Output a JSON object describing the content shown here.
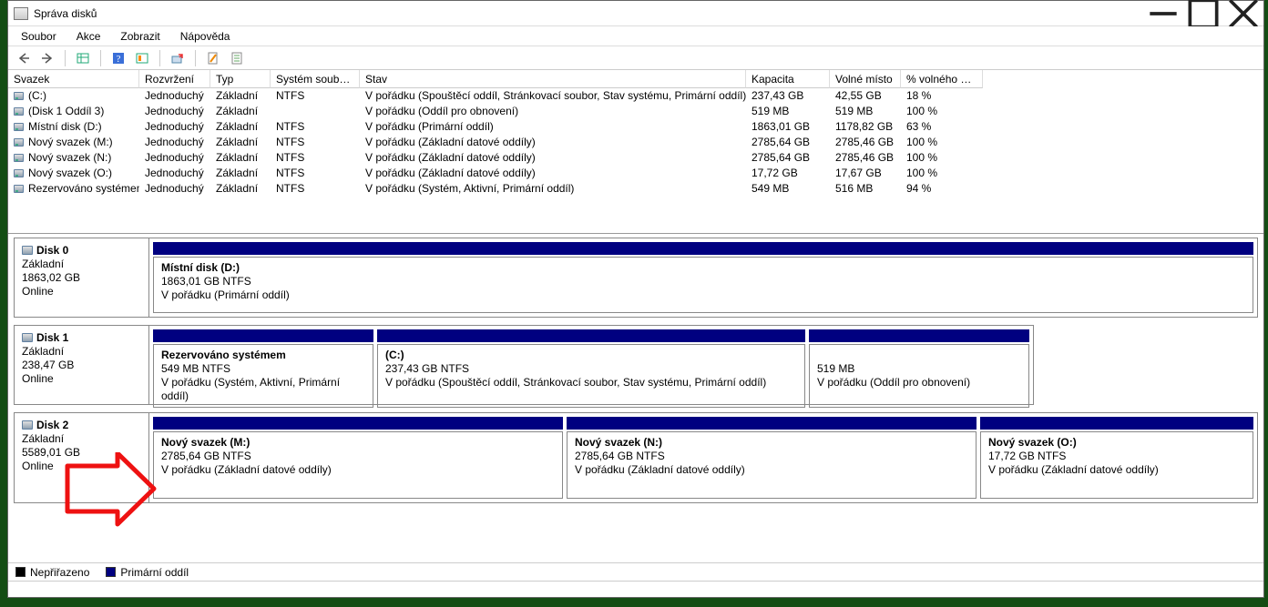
{
  "window": {
    "title": "Správa disků"
  },
  "menu": {
    "file": "Soubor",
    "action": "Akce",
    "view": "Zobrazit",
    "help": "Nápověda"
  },
  "columns": {
    "vol": "Svazek",
    "layout": "Rozvržení",
    "type": "Typ",
    "fs": "Systém souborů",
    "status": "Stav",
    "capacity": "Kapacita",
    "free": "Volné místo",
    "pctfree": "% volného m…"
  },
  "volumes": [
    {
      "name": "(C:)",
      "layout": "Jednoduchý",
      "type": "Základní",
      "fs": "NTFS",
      "status": "V pořádku (Spouštěcí oddíl, Stránkovací soubor, Stav systému, Primární oddíl)",
      "cap": "237,43 GB",
      "free": "42,55 GB",
      "pct": "18 %"
    },
    {
      "name": "(Disk 1 Oddíl 3)",
      "layout": "Jednoduchý",
      "type": "Základní",
      "fs": "",
      "status": "V pořádku (Oddíl pro obnovení)",
      "cap": "519 MB",
      "free": "519 MB",
      "pct": "100 %"
    },
    {
      "name": "Místní disk (D:)",
      "layout": "Jednoduchý",
      "type": "Základní",
      "fs": "NTFS",
      "status": "V pořádku (Primární oddíl)",
      "cap": "1863,01 GB",
      "free": "1178,82 GB",
      "pct": "63 %"
    },
    {
      "name": "Nový svazek (M:)",
      "layout": "Jednoduchý",
      "type": "Základní",
      "fs": "NTFS",
      "status": "V pořádku (Základní datové oddíly)",
      "cap": "2785,64 GB",
      "free": "2785,46 GB",
      "pct": "100 %"
    },
    {
      "name": "Nový svazek (N:)",
      "layout": "Jednoduchý",
      "type": "Základní",
      "fs": "NTFS",
      "status": "V pořádku (Základní datové oddíly)",
      "cap": "2785,64 GB",
      "free": "2785,46 GB",
      "pct": "100 %"
    },
    {
      "name": "Nový svazek (O:)",
      "layout": "Jednoduchý",
      "type": "Základní",
      "fs": "NTFS",
      "status": "V pořádku (Základní datové oddíly)",
      "cap": "17,72 GB",
      "free": "17,67 GB",
      "pct": "100 %"
    },
    {
      "name": "Rezervováno systémem",
      "layout": "Jednoduchý",
      "type": "Základní",
      "fs": "NTFS",
      "status": "V pořádku (Systém, Aktivní, Primární oddíl)",
      "cap": "549 MB",
      "free": "516 MB",
      "pct": "94 %"
    }
  ],
  "disks": {
    "d0": {
      "name": "Disk 0",
      "type": "Základní",
      "cap": "1863,02 GB",
      "state": "Online",
      "p0": {
        "title": "Místní disk  (D:)",
        "size": "1863,01 GB NTFS",
        "status": "V pořádku (Primární oddíl)"
      }
    },
    "d1": {
      "name": "Disk 1",
      "type": "Základní",
      "cap": "238,47 GB",
      "state": "Online",
      "p0": {
        "title": "Rezervováno systémem",
        "size": "549 MB NTFS",
        "status": "V pořádku (Systém, Aktivní, Primární oddíl)"
      },
      "p1": {
        "title": "(C:)",
        "size": "237,43 GB NTFS",
        "status": "V pořádku (Spouštěcí oddíl, Stránkovací soubor, Stav systému, Primární oddíl)"
      },
      "p2": {
        "title": "",
        "size": "519 MB",
        "status": "V pořádku (Oddíl pro obnovení)"
      }
    },
    "d2": {
      "name": "Disk 2",
      "type": "Základní",
      "cap": "5589,01 GB",
      "state": "Online",
      "p0": {
        "title": "Nový svazek  (M:)",
        "size": "2785,64 GB NTFS",
        "status": "V pořádku (Základní datové oddíly)"
      },
      "p1": {
        "title": "Nový svazek  (N:)",
        "size": "2785,64 GB NTFS",
        "status": "V pořádku (Základní datové oddíly)"
      },
      "p2": {
        "title": "Nový svazek  (O:)",
        "size": "17,72 GB NTFS",
        "status": "V pořádku (Základní datové oddíly)"
      }
    }
  },
  "legend": {
    "unallocated": "Nepřiřazeno",
    "primary": "Primární oddíl"
  }
}
